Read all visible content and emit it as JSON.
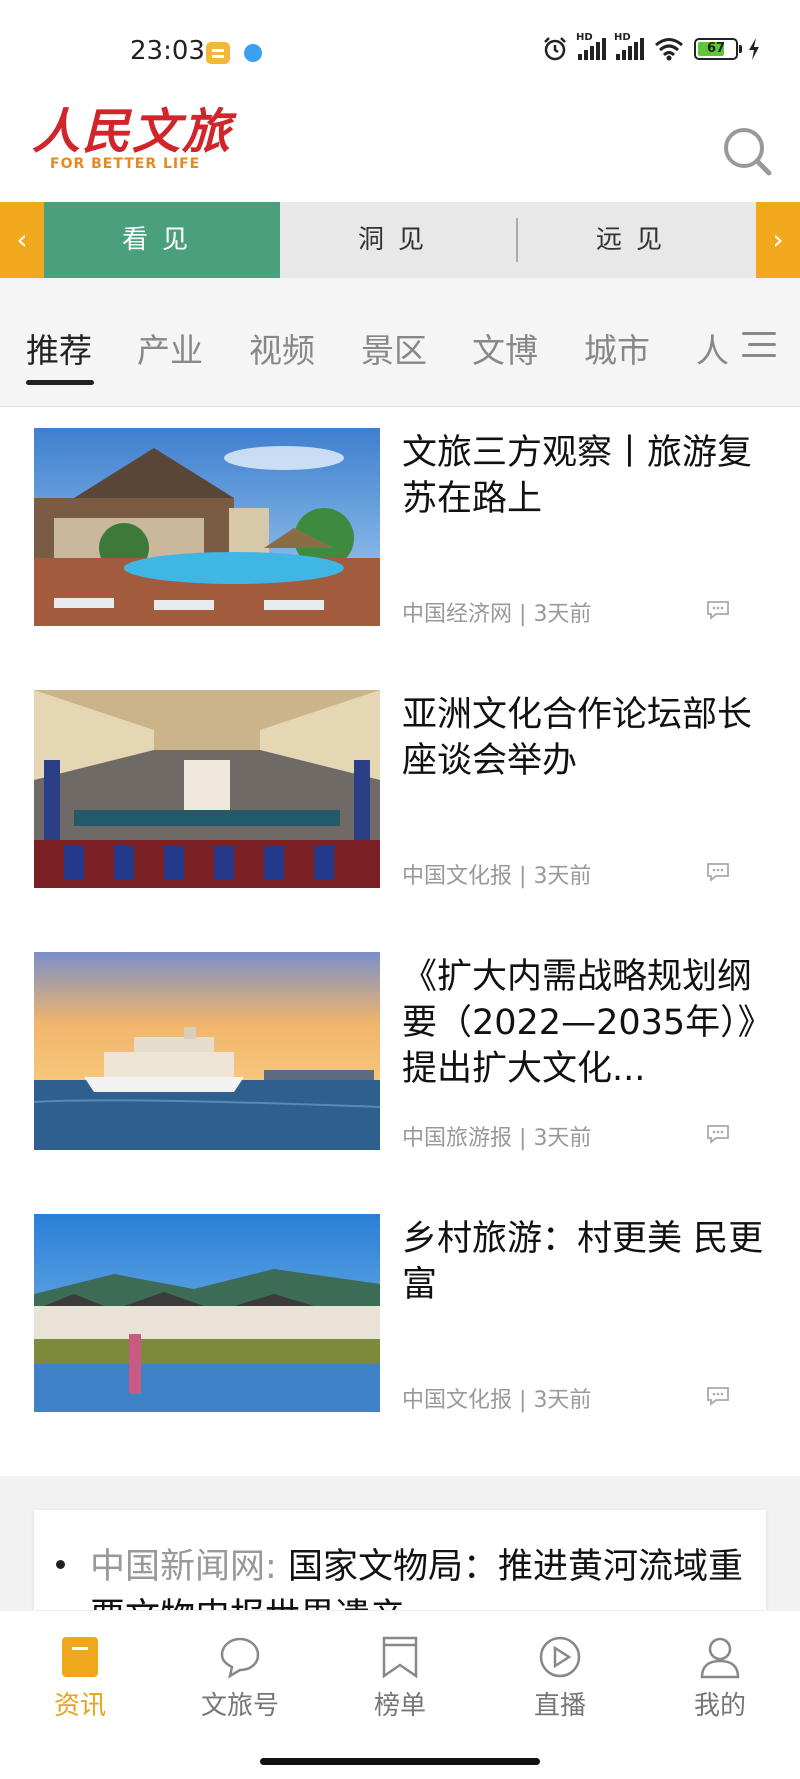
{
  "status": {
    "time": "23:03",
    "battery": "67",
    "net1": "HD",
    "net2": "HD"
  },
  "header": {
    "logo_cn": "人民文旅",
    "logo_en": "FOR BETTER LIFE"
  },
  "view_tabs": [
    {
      "label": "看见"
    },
    {
      "label": "洞见"
    },
    {
      "label": "远见"
    }
  ],
  "categories": [
    "推荐",
    "产业",
    "视频",
    "景区",
    "文博",
    "城市",
    "人"
  ],
  "news": [
    {
      "title": "文旅三方观察丨旅游复苏在路上",
      "source": "中国经济网",
      "sep": "|",
      "time": "3天前"
    },
    {
      "title": "亚洲文化合作论坛部长座谈会举办",
      "source": "中国文化报",
      "sep": "|",
      "time": "3天前"
    },
    {
      "title": "《扩大内需战略规划纲要（2022—2035年）》提出扩大文化...",
      "source": "中国旅游报",
      "sep": "|",
      "time": "3天前"
    },
    {
      "title": "乡村旅游：村更美 民更富",
      "source": "中国文化报",
      "sep": "|",
      "time": "3天前"
    }
  ],
  "flash": {
    "source": "中国新闻网:",
    "text": "国家文物局：推进黄河流域重要文物申报世界遗产"
  },
  "bottom_nav": [
    {
      "label": "资讯"
    },
    {
      "label": "文旅号"
    },
    {
      "label": "榜单"
    },
    {
      "label": "直播"
    },
    {
      "label": "我的"
    }
  ],
  "colors": {
    "accent": "#f2a81d",
    "active_tab": "#4a9f7d",
    "brand_red": "#d0252b",
    "nav_active": "#e7a318"
  }
}
